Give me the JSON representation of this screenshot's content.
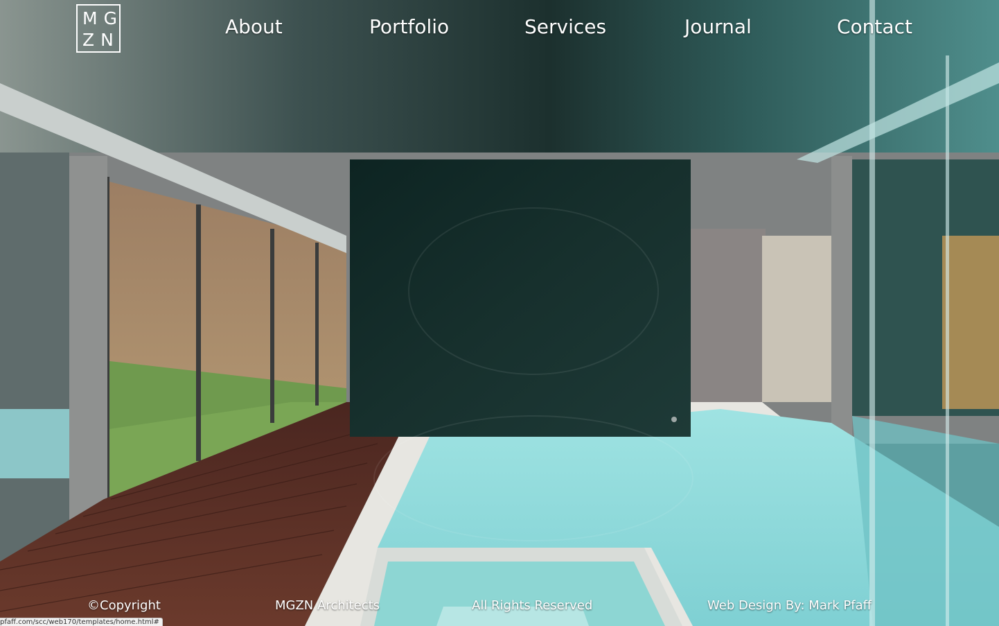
{
  "logo": {
    "line1": "MG",
    "line2": "ZN"
  },
  "nav": {
    "about": "About",
    "portfolio": "Portfolio",
    "services": "Services",
    "journal": "Journal",
    "contact": "Contact"
  },
  "footer": {
    "copyright": "©Copyright",
    "company": "MGZN Architects",
    "rights": "All Rights Reserved",
    "credit": "Web Design By: Mark Pfaff"
  },
  "status_bar": {
    "url": "pfaff.com/scc/web170/templates/home.html#"
  },
  "colors": {
    "nav_text": "#ffffff",
    "pool_water": "#8fdcdc",
    "ceiling": "#1f3a38",
    "deck_wood": "#5a2f25"
  }
}
